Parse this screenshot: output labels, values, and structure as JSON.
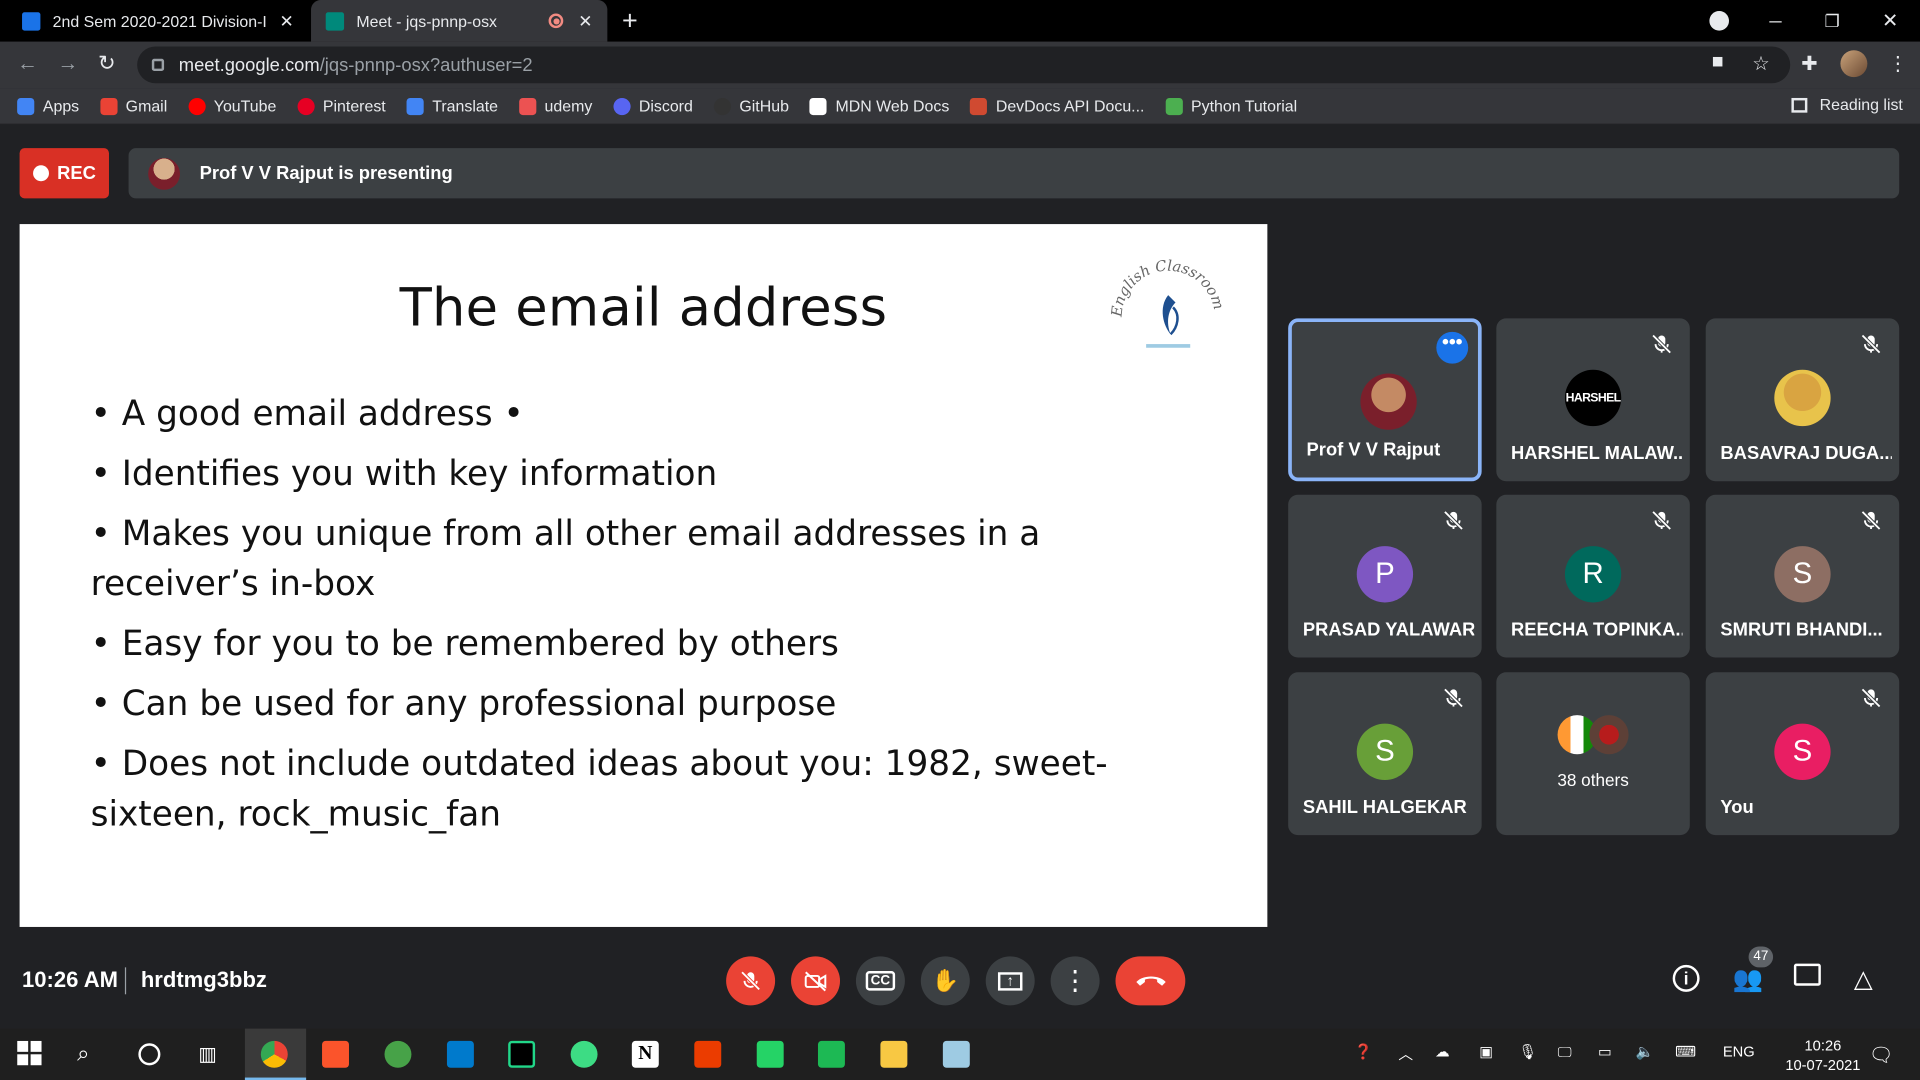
{
  "browser": {
    "tabs": [
      {
        "title": "2nd Sem 2020-2021 Division-I",
        "active": false,
        "favicon_color": "#1a73e8"
      },
      {
        "title": "Meet - jqs-pnnp-osx",
        "active": true,
        "favicon_color": "#00897b"
      }
    ],
    "url_host": "meet.google.com",
    "url_path": "/jqs-pnnp-osx?authuser=2",
    "bookmarks": [
      {
        "label": "Apps",
        "icon": "apps-grid-icon",
        "color": "#4285f4"
      },
      {
        "label": "Gmail",
        "icon": "gmail-icon",
        "color": "#ea4335"
      },
      {
        "label": "YouTube",
        "icon": "youtube-icon",
        "color": "#ff0000"
      },
      {
        "label": "Pinterest",
        "icon": "pinterest-icon",
        "color": "#e60023"
      },
      {
        "label": "Translate",
        "icon": "translate-icon",
        "color": "#4285f4"
      },
      {
        "label": "udemy",
        "icon": "udemy-icon",
        "color": "#ec5252"
      },
      {
        "label": "Discord",
        "icon": "discord-icon",
        "color": "#5865f2"
      },
      {
        "label": "GitHub",
        "icon": "github-icon",
        "color": "#333333"
      },
      {
        "label": "MDN Web Docs",
        "icon": "mdn-icon",
        "color": "#ffffff"
      },
      {
        "label": "DevDocs API Docu...",
        "icon": "devdocs-icon",
        "color": "#d04a31"
      },
      {
        "label": "Python Tutorial",
        "icon": "python-icon",
        "color": "#4caf50"
      }
    ],
    "reading_list": "Reading list"
  },
  "meet": {
    "rec_label": "REC",
    "presenting_text": "Prof V V Rajput is presenting",
    "slide": {
      "title": "The email address",
      "logo_text": "English Classroom",
      "bullets": [
        "•  A good email address •",
        "•  Identifies you with key information",
        "• Makes you unique from all other email addresses in a receiver’s in-box",
        "• Easy for you to be remembered by others",
        "• Can be used for any professional purpose",
        "• Does not include outdated ideas about you: 1982, sweet-sixteen, rock_music_fan"
      ]
    },
    "participants": [
      {
        "name": "Prof V V Rajput",
        "initial": "",
        "color": "#a0522d",
        "muted": false
      },
      {
        "name": "HARSHEL MALAW...",
        "initial": "HARSHEL",
        "color": "#000000",
        "muted": true
      },
      {
        "name": "BASAVRAJ DUGA...",
        "initial": "",
        "color": "#d9a441",
        "muted": true
      },
      {
        "name": "PRASAD YALAWAR",
        "initial": "P",
        "color": "#7e57c2",
        "muted": true
      },
      {
        "name": "REECHA TOPINKA...",
        "initial": "R",
        "color": "#00695c",
        "muted": true
      },
      {
        "name": "SMRUTI BHANDI...",
        "initial": "S",
        "color": "#8d6e63",
        "muted": true
      },
      {
        "name": "SAHIL HALGEKAR",
        "initial": "S",
        "color": "#689f38",
        "muted": true
      },
      {
        "name": "38 others",
        "initial": "",
        "color": "#3c4043",
        "muted": false
      },
      {
        "name": "You",
        "initial": "S",
        "color": "#e91e63",
        "muted": true
      }
    ],
    "time": "10:26 AM",
    "meeting_code": "hrdtmg3bbz",
    "people_count": "47"
  },
  "taskbar": {
    "language": "ENG",
    "time": "10:26",
    "date": "10-07-2021"
  }
}
